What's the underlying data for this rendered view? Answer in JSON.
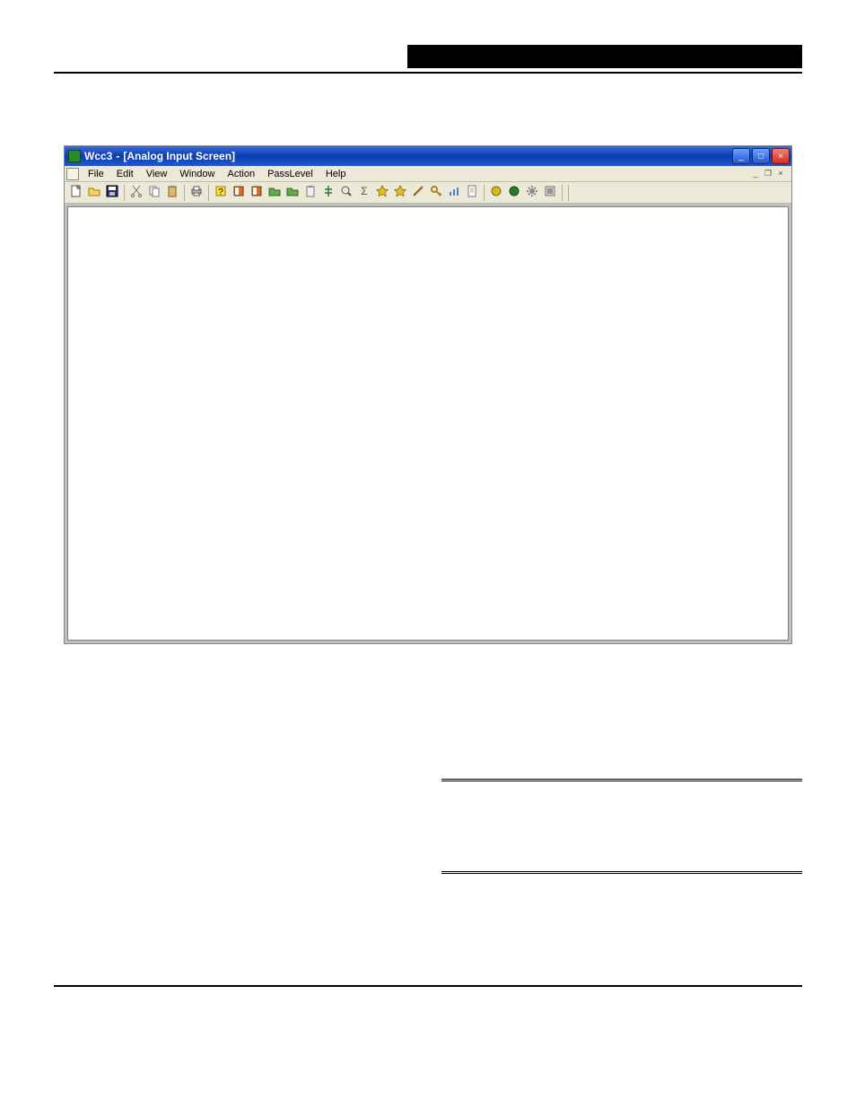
{
  "titlebar": {
    "app": "Wcc3",
    "sep": "-",
    "subtitle": "[Analog Input Screen]"
  },
  "menubar": {
    "items": [
      "File",
      "Edit",
      "View",
      "Window",
      "Action",
      "PassLevel",
      "Help"
    ]
  },
  "toolbar": {
    "icons": [
      "new-icon",
      "open-icon",
      "save-icon",
      "sep",
      "cut-icon",
      "copy-icon",
      "paste-icon",
      "sep",
      "print-icon",
      "sep",
      "help-icon",
      "book1-icon",
      "book2-icon",
      "folder1-icon",
      "folder2-icon",
      "clipboard-icon",
      "tree-icon",
      "find-icon",
      "sigma-icon",
      "star1-icon",
      "star2-icon",
      "wand-icon",
      "key-icon",
      "chart-icon",
      "doc-icon",
      "sep",
      "ball1-icon",
      "ball2-icon",
      "gear-icon",
      "cfg-icon",
      "sep"
    ]
  },
  "winbuttons": {
    "min": "_",
    "max": "□",
    "close": "×"
  },
  "mdibuttons": {
    "min": "_",
    "restore": "❐",
    "close": "×"
  }
}
